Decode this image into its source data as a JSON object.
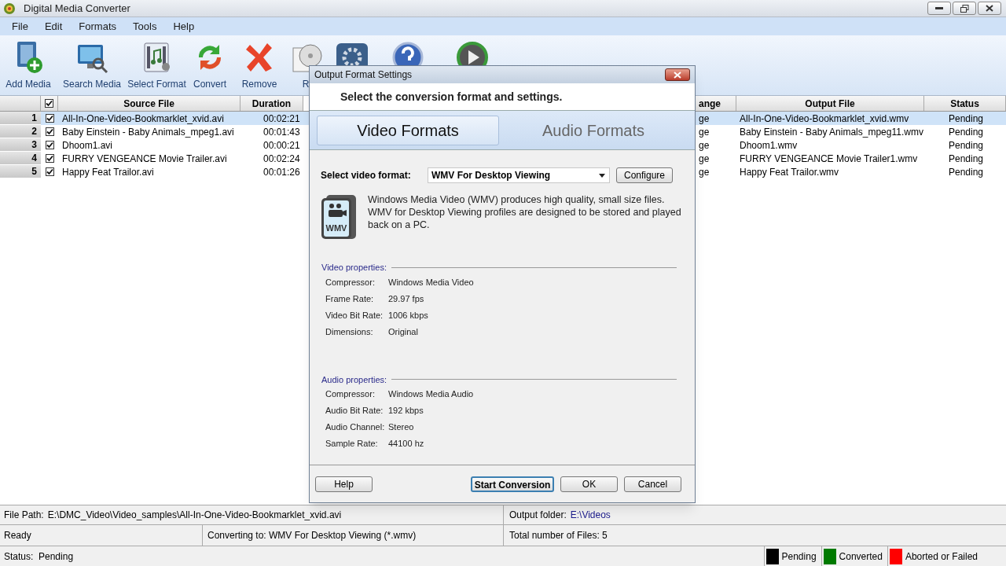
{
  "window": {
    "title": "Digital Media Converter"
  },
  "menu": [
    "File",
    "Edit",
    "Formats",
    "Tools",
    "Help"
  ],
  "toolbar": [
    "Add Media",
    "Search Media",
    "Select Format",
    "Convert",
    "Remove",
    "R"
  ],
  "table": {
    "all_checked": true,
    "columns": [
      "Source File",
      "Duration",
      "ange",
      "Output File",
      "Status"
    ],
    "rows": [
      {
        "number": "1",
        "checked": true,
        "selected": true,
        "source": "All-In-One-Video-Bookmarklet_xvid.avi",
        "duration": "00:02:21",
        "column_3": "ge",
        "output": "All-In-One-Video-Bookmarklet_xvid.wmv",
        "status": "Pending"
      },
      {
        "number": "2",
        "checked": true,
        "selected": false,
        "source": "Baby Einstein - Baby Animals_mpeg1.avi",
        "duration": "00:01:43",
        "column_3": "ge",
        "output": "Baby Einstein - Baby Animals_mpeg11.wmv",
        "status": "Pending"
      },
      {
        "number": "3",
        "checked": true,
        "selected": false,
        "source": "Dhoom1.avi",
        "duration": "00:00:21",
        "column_3": "ge",
        "output": "Dhoom1.wmv",
        "status": "Pending"
      },
      {
        "number": "4",
        "checked": true,
        "selected": false,
        "source": "FURRY VENGEANCE Movie Trailer.avi",
        "duration": "00:02:24",
        "column_3": "ge",
        "output": "FURRY VENGEANCE Movie Trailer1.wmv",
        "status": "Pending"
      },
      {
        "number": "5",
        "checked": true,
        "selected": false,
        "source": "Happy Feat Trailor.avi",
        "duration": "00:01:26",
        "column_3": "ge",
        "output": "Happy Feat Trailor.wmv",
        "status": "Pending"
      }
    ]
  },
  "dialog": {
    "title": "Output Format Settings",
    "heading": "Select the conversion format and settings.",
    "tabs": [
      {
        "label": "Video Formats",
        "selected": true
      },
      {
        "label": "Audio Formats",
        "selected": false
      }
    ],
    "format_label": "Select video format:",
    "format_value": "WMV For Desktop Viewing",
    "configure": "Configure",
    "description": "Windows Media Video (WMV) produces high quality, small size files. WMV for Desktop Viewing  profiles are designed to be stored and played back on a PC.",
    "icon_label": "WMV",
    "groups": [
      {
        "title": "Video properties:",
        "props": [
          [
            "Compressor:",
            "Windows Media Video"
          ],
          [
            "Frame Rate:",
            "29.97 fps"
          ],
          [
            "Video Bit Rate:",
            "1006 kbps"
          ],
          [
            "Dimensions:",
            "Original"
          ]
        ]
      },
      {
        "title": "Audio properties:",
        "props": [
          [
            "Compressor:",
            "Windows Media Audio"
          ],
          [
            "Audio Bit Rate:",
            "192 kbps"
          ],
          [
            "Audio Channel:",
            "Stereo"
          ],
          [
            "Sample Rate:",
            "44100 hz"
          ]
        ]
      }
    ],
    "buttons": [
      {
        "label": "Help",
        "default": false
      },
      {
        "label": "Start Conversion",
        "default": true
      },
      {
        "label": "OK",
        "default": false
      },
      {
        "label": "Cancel",
        "default": false
      }
    ]
  },
  "status_bar": {
    "file_path_label": "File Path:",
    "file_path": "E:\\DMC_Video\\Video_samples\\All-In-One-Video-Bookmarklet_xvid.avi",
    "output_label": "Output folder:",
    "output_folder": "E:\\Videos",
    "ready": "Ready",
    "converting": "Converting to: WMV For Desktop Viewing (*.wmv)",
    "total": "Total number of Files: 5",
    "status": "Status:  Pending",
    "legend": [
      {
        "label": "Pending",
        "color": "#000000"
      },
      {
        "label": "Converted",
        "color": "#007a00"
      },
      {
        "label": "Aborted or Failed",
        "color": "#ff0000"
      }
    ]
  }
}
